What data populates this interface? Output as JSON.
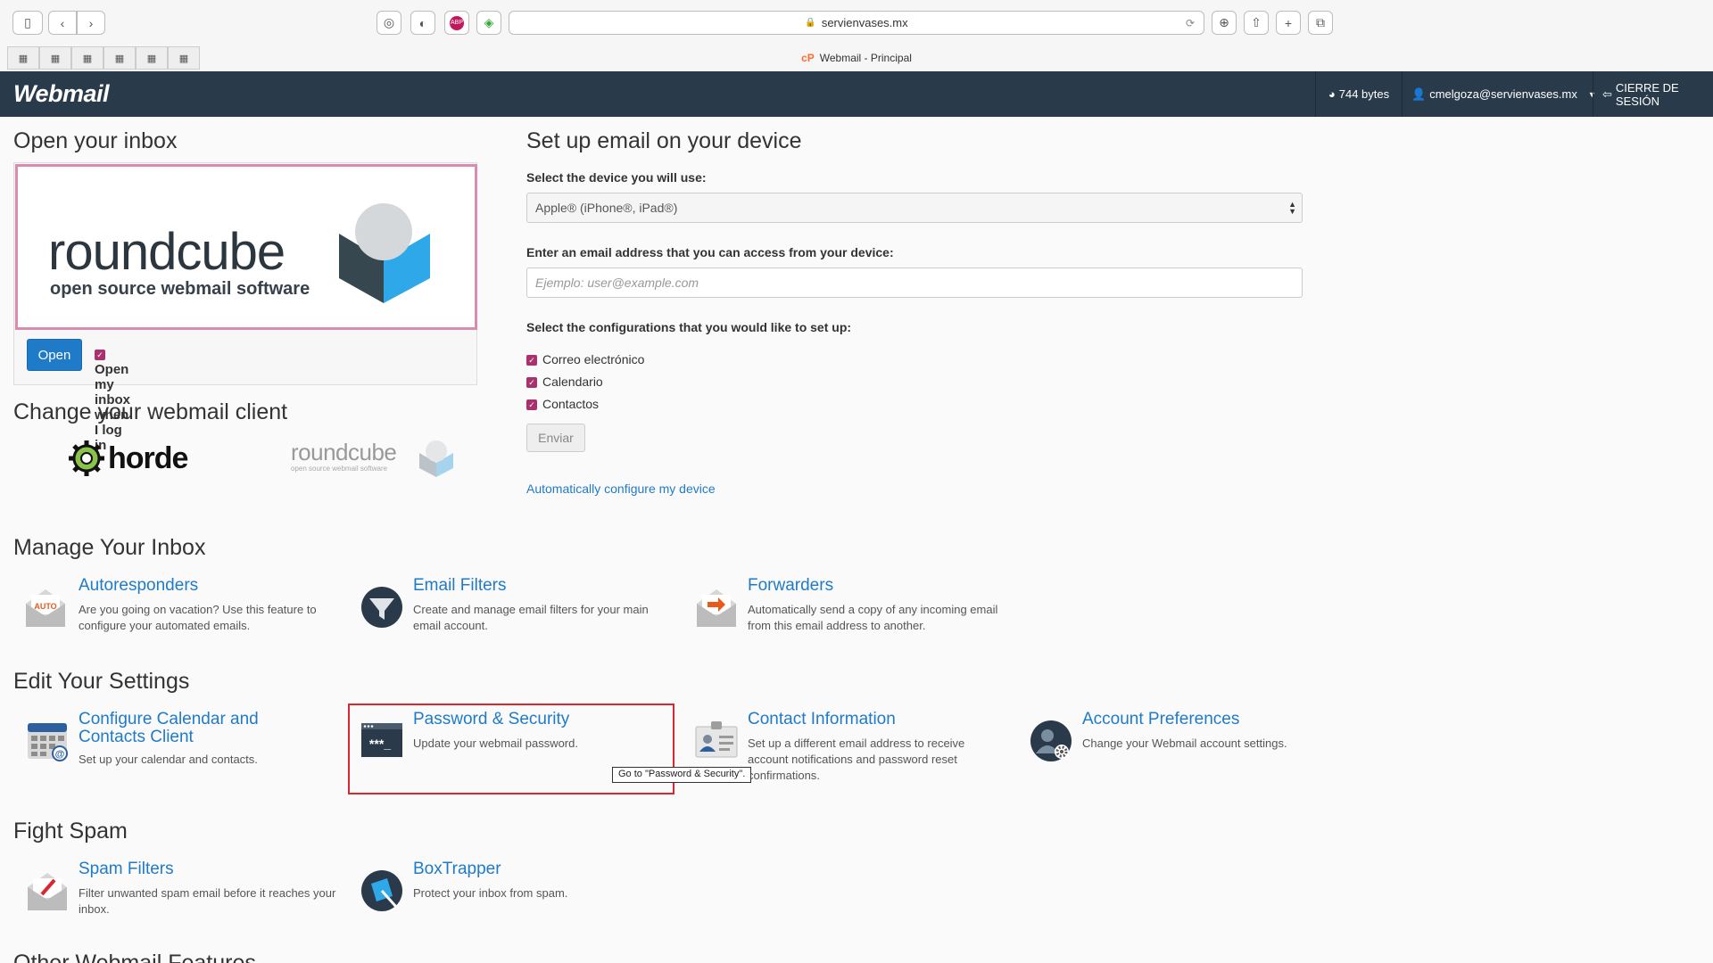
{
  "browser": {
    "url": "servienvases.mx",
    "tab_title": "Webmail - Principal",
    "cp_mark": "cP",
    "bookmarks": [
      "▦",
      "▦",
      "▦",
      "▦",
      "▦",
      "▦"
    ]
  },
  "header": {
    "logo": "Webmail",
    "disk_usage": "744 bytes",
    "user": "cmelgoza@servienvases.mx",
    "logout": "CIERRE DE SESIÓN"
  },
  "inbox": {
    "title": "Open your inbox",
    "rc_word": "roundcube",
    "rc_tagline": "open source webmail software",
    "open_button": "Open",
    "open_checkbox": "Open my inbox when I log in"
  },
  "client": {
    "title": "Change your webmail client",
    "horde": "horde",
    "rc_small": "roundcube",
    "rc_small_tag": "open source webmail software"
  },
  "device": {
    "title": "Set up email on your device",
    "select_label": "Select the device you will use:",
    "select_value": "Apple® (iPhone®, iPad®)",
    "email_label": "Enter an email address that you can access from your device:",
    "email_placeholder": "Ejemplo: user@example.com",
    "config_label": "Select the configurations that you would like to set up:",
    "configs": [
      "Correo electrónico",
      "Calendario",
      "Contactos"
    ],
    "submit": "Enviar",
    "auto_link": "Automatically configure my device"
  },
  "manage": {
    "title": "Manage Your Inbox",
    "items": [
      {
        "title": "Autoresponders",
        "desc": "Are you going on vacation? Use this feature to configure your automated emails."
      },
      {
        "title": "Email Filters",
        "desc": "Create and manage email filters for your main email account."
      },
      {
        "title": "Forwarders",
        "desc": "Automatically send a copy of any incoming email from this email address to another."
      }
    ]
  },
  "settings": {
    "title": "Edit Your Settings",
    "items": [
      {
        "title": "Configure Calendar and Contacts Client",
        "desc": "Set up your calendar and contacts."
      },
      {
        "title": "Password & Security",
        "desc": "Update your webmail password."
      },
      {
        "title": "Contact Information",
        "desc": "Set up a different email address to receive account notifications and password reset confirmations."
      },
      {
        "title": "Account Preferences",
        "desc": "Change your Webmail account settings."
      }
    ],
    "tooltip": "Go to \"Password & Security\"."
  },
  "spam": {
    "title": "Fight Spam",
    "items": [
      {
        "title": "Spam Filters",
        "desc": "Filter unwanted spam email before it reaches your inbox."
      },
      {
        "title": "BoxTrapper",
        "desc": "Protect your inbox from spam."
      }
    ]
  },
  "other": {
    "title": "Other Webmail Features"
  },
  "colors": {
    "nav_bg": "#293a4a",
    "link": "#1f7bc8",
    "checkbox": "#a8326e",
    "highlight": "#d9262f"
  }
}
